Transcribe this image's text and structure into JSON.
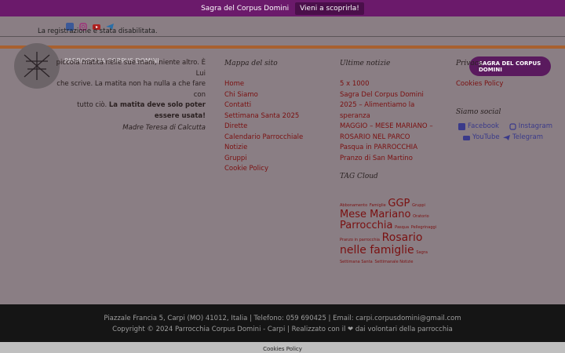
{
  "topbar": {
    "text": "Sagra del Corpus Domini",
    "cta": "Vieni a scoprirla!"
  },
  "notice": "La registrazione è stata disabilitata.",
  "site": {
    "name": "PARROCCHIA CORPUS DOMINI"
  },
  "header_cta": {
    "label_line1": "SAGRA DEL CORPUS",
    "label_line2": "DOMINI"
  },
  "quote": {
    "line1": "piccola matita nelle sue mani, niente altro. È Lui",
    "line2": "che scrive. La matita non ha nulla a che fare con",
    "line3_prefix": "tutto ciò.",
    "line3_bold": "La matita deve solo poter essere usata!",
    "author": "Madre Teresa di Calcutta"
  },
  "sitemap": {
    "title": "Mappa del sito",
    "links": [
      "Home",
      "Chi Siamo",
      "Contatti",
      "Settimana Santa 2025",
      "Dirette",
      "Calendario Parrocchiale",
      "Notizie",
      "Gruppi",
      "Cookie Policy"
    ]
  },
  "news": {
    "title": "Ultime notizie",
    "links": [
      "5 x 1000",
      "Sagra Del Corpus Domini 2025 – Alimentiamo la speranza",
      "MAGGIO – MESE MARIANO – ROSARIO NEL PARCO",
      "Pasqua in PARROCCHIA",
      "Pranzo di San Martino"
    ]
  },
  "privacy": {
    "title": "Privacy",
    "link": "Cookies Policy"
  },
  "tags": {
    "title": "TAG Cloud",
    "items": [
      "Abbonamento",
      "Famiglie",
      "GGP",
      "Gruppi",
      "Mese Mariano",
      "Oratorio",
      "Parrocchia",
      "Pasqua",
      "Pellegrinaggi",
      "Pranzo in parrocchia",
      "Rosario nelle famiglie",
      "Sagra",
      "Settimana Santa",
      "Settimanale Notizie"
    ]
  },
  "social": {
    "title": "Siamo social",
    "items": [
      {
        "label": "Facebook",
        "icon": "facebook-icon"
      },
      {
        "label": "Instagram",
        "icon": "instagram-icon"
      },
      {
        "label": "YouTube",
        "icon": "youtube-icon"
      },
      {
        "label": "Telegram",
        "icon": "telegram-icon"
      }
    ]
  },
  "footer": {
    "line1": "Piazzale Francia 5, Carpi (MO) 41012, Italia | Telefono: 059 690425 | Email: carpi.corpusdomini@gmail.com",
    "line2": "Copyright © 2024 Parrocchia Corpus Domini - Carpi | Realizzato con il ❤ dai volontari della parrocchia"
  },
  "bottombar": {
    "link": "Cookies Policy"
  },
  "colors": {
    "topbar": "#6b1a6b",
    "link": "#7a1010",
    "accent_bar": "#a8602f",
    "footer": "#151515"
  }
}
